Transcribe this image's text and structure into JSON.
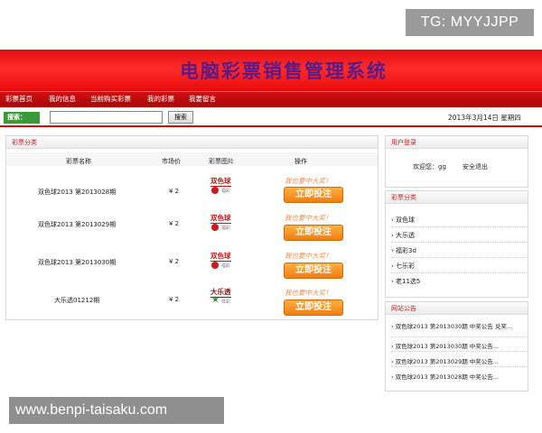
{
  "watermark_top": "TG: MYYJJPP",
  "watermark_bottom": "www.benpi-taisaku.com",
  "header": {
    "title": "电脑彩票销售管理系统"
  },
  "nav": [
    {
      "label": "彩票首页"
    },
    {
      "label": "我的信息"
    },
    {
      "label": "当前购买彩票"
    },
    {
      "label": "我的彩票"
    },
    {
      "label": "我要留言"
    }
  ],
  "search": {
    "tag": "搜索：",
    "button": "搜索",
    "value": "",
    "date": "2013年3月14日 星期四"
  },
  "main": {
    "title": "彩票分类",
    "columns": [
      "彩票名称",
      "市场价",
      "彩票图片",
      "操作"
    ],
    "rows": [
      {
        "name": "双色球2013 第2013028期",
        "price": "¥ 2",
        "logo": "双色球",
        "logo_sub": "福彩",
        "slogan": "我也要中大奖！",
        "button": "立即投注"
      },
      {
        "name": "双色球2013 第2013029期",
        "price": "¥ 2",
        "logo": "双色球",
        "logo_sub": "福彩",
        "slogan": "我也要中大奖！",
        "button": "立即投注"
      },
      {
        "name": "双色球2013 第2013030期",
        "price": "¥ 2",
        "logo": "双色球",
        "logo_sub": "福彩",
        "slogan": "我也要中大奖！",
        "button": "立即投注"
      },
      {
        "name": "大乐透01212期",
        "price": "¥ 2",
        "logo": "大乐透",
        "logo_sub": "体彩",
        "slogan": "我也要中大奖！",
        "button": "立即投注"
      }
    ]
  },
  "login": {
    "title": "用户登录",
    "welcome": "欢迎您：gg",
    "logout": "安全退出"
  },
  "categories": {
    "title": "彩票分类",
    "items": [
      "› 双色球",
      "› 大乐透",
      "› 福彩3d",
      "› 七乐彩",
      "› 老11选5"
    ]
  },
  "notices": {
    "title": "网站公告",
    "items": [
      "› 双色球2013 第2013030期 中奖公告 兑奖...",
      "› 双色球2013 第2013030期 中奖公告...",
      "› 双色球2013 第2013029期 中奖公告...",
      "› 双色球2013 第2013028期 中奖公告..."
    ]
  },
  "colors": {
    "brand_red": "#e01010",
    "title_purple": "#5a1a8a",
    "button_orange": "#f07d10",
    "search_green": "#3a9a3a"
  }
}
